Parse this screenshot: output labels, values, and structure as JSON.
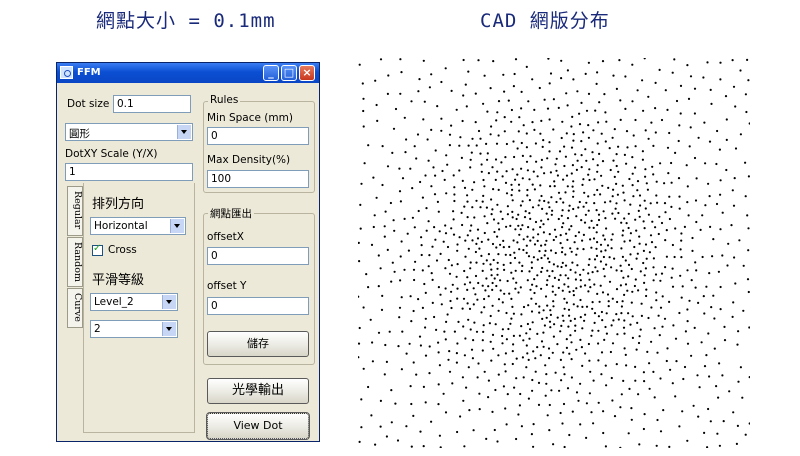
{
  "headings": {
    "left": "網點大小 = 0.1mm",
    "right": "CAD 網版分布"
  },
  "window": {
    "title": "FFM",
    "controls": [
      "minimize-icon",
      "maximize-icon",
      "close-icon"
    ]
  },
  "form": {
    "dot_size_label": "Dot size",
    "dot_size_value": "0.1",
    "shape_selected": "圓形",
    "dotxy_scale_label": "DotXY Scale (Y/X)",
    "dotxy_scale_value": "1",
    "tabs": [
      "Regular",
      "Random",
      "Curve"
    ],
    "arrangement_label": "排列方向",
    "arrangement_selected": "Horizontal",
    "cross_label": "Cross",
    "cross_checked": true,
    "smooth_label": "平滑等級",
    "level_selected": "Level_2",
    "level2_selected": "2"
  },
  "rules": {
    "title": "Rules",
    "min_space_label": "Min Space (mm)",
    "min_space_value": "0",
    "max_density_label": "Max Density(%)",
    "max_density_value": "100"
  },
  "output_group": {
    "title": "網點匯出",
    "offset_x_label": "offsetX",
    "offset_x_value": "0",
    "offset_y_label": "offset Y",
    "offset_y_value": "0",
    "save_label": "儲存"
  },
  "buttons": {
    "optical_output_label": "光學輸出",
    "view_dot_label": "View Dot"
  },
  "colors": {
    "heading_text": "#1a2a7a",
    "titlebar": "#0b4fd3",
    "window_bg": "#ece9d8",
    "dots": "#000000"
  }
}
